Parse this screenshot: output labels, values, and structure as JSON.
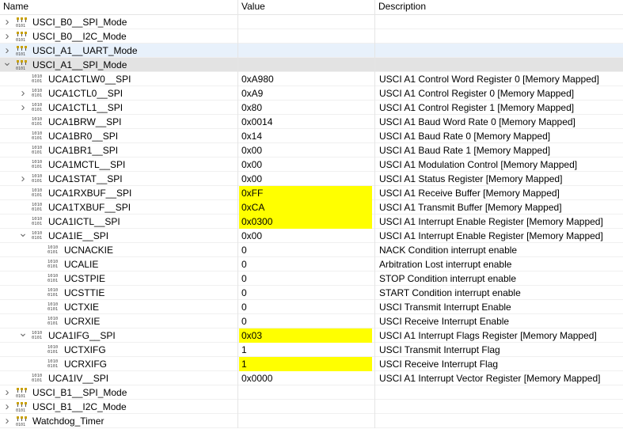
{
  "columns": {
    "name": "Name",
    "value": "Value",
    "description": "Description"
  },
  "colors": {
    "highlight": "#ffff00",
    "selected_light": "#e8f1fb",
    "selected_grey": "#e3e3e3"
  },
  "rows": [
    {
      "name": "USCI_B0__SPI_Mode",
      "value": "",
      "desc": "",
      "icon": "peripheral-icon",
      "expander": "collapsed"
    },
    {
      "name": "USCI_B0__I2C_Mode",
      "value": "",
      "desc": "",
      "icon": "peripheral-icon",
      "expander": "collapsed"
    },
    {
      "name": "USCI_A1__UART_Mode",
      "value": "",
      "desc": "",
      "icon": "peripheral-icon",
      "expander": "collapsed",
      "state": "hover"
    },
    {
      "name": "USCI_A1__SPI_Mode",
      "value": "",
      "desc": "",
      "icon": "peripheral-icon",
      "expander": "expanded",
      "state": "selected"
    },
    {
      "name": "UCA1CTLW0__SPI",
      "value": "0xA980",
      "desc": "USCI A1 Control Word Register 0 [Memory Mapped]",
      "icon": "register-icon",
      "expander": "none"
    },
    {
      "name": "UCA1CTL0__SPI",
      "value": "0xA9",
      "desc": "USCI A1 Control Register 0 [Memory Mapped]",
      "icon": "register-icon",
      "expander": "collapsed"
    },
    {
      "name": "UCA1CTL1__SPI",
      "value": "0x80",
      "desc": "USCI A1 Control Register 1 [Memory Mapped]",
      "icon": "register-icon",
      "expander": "collapsed"
    },
    {
      "name": "UCA1BRW__SPI",
      "value": "0x0014",
      "desc": "USCI A1 Baud Word Rate 0 [Memory Mapped]",
      "icon": "register-icon",
      "expander": "none"
    },
    {
      "name": "UCA1BR0__SPI",
      "value": "0x14",
      "desc": "USCI A1 Baud Rate 0 [Memory Mapped]",
      "icon": "register-icon",
      "expander": "none"
    },
    {
      "name": "UCA1BR1__SPI",
      "value": "0x00",
      "desc": "USCI A1 Baud Rate 1 [Memory Mapped]",
      "icon": "register-icon",
      "expander": "none"
    },
    {
      "name": "UCA1MCTL__SPI",
      "value": "0x00",
      "desc": "USCI A1 Modulation Control [Memory Mapped]",
      "icon": "register-icon",
      "expander": "none"
    },
    {
      "name": "UCA1STAT__SPI",
      "value": "0x00",
      "desc": "USCI A1 Status Register [Memory Mapped]",
      "icon": "register-icon",
      "expander": "collapsed"
    },
    {
      "name": "UCA1RXBUF__SPI",
      "value": "0xFF",
      "desc": "USCI A1 Receive Buffer [Memory Mapped]",
      "icon": "register-icon",
      "expander": "none",
      "changed": true
    },
    {
      "name": "UCA1TXBUF__SPI",
      "value": "0xCA",
      "desc": "USCI A1 Transmit Buffer [Memory Mapped]",
      "icon": "register-icon",
      "expander": "none",
      "changed": true
    },
    {
      "name": "UCA1ICTL__SPI",
      "value": "0x0300",
      "desc": "USCI A1 Interrupt Enable Register [Memory Mapped]",
      "icon": "register-icon",
      "expander": "none",
      "changed": true
    },
    {
      "name": "UCA1IE__SPI",
      "value": "0x00",
      "desc": "USCI A1 Interrupt Enable Register [Memory Mapped]",
      "icon": "register-icon",
      "expander": "expanded"
    },
    {
      "name": "UCNACKIE",
      "value": "0",
      "desc": "NACK Condition interrupt enable",
      "icon": "register-icon",
      "expander": "none",
      "level": 2
    },
    {
      "name": "UCALIE",
      "value": "0",
      "desc": "Arbitration Lost interrupt enable",
      "icon": "register-icon",
      "expander": "none",
      "level": 2
    },
    {
      "name": "UCSTPIE",
      "value": "0",
      "desc": "STOP Condition interrupt enable",
      "icon": "register-icon",
      "expander": "none",
      "level": 2
    },
    {
      "name": "UCSTTIE",
      "value": "0",
      "desc": "START Condition interrupt enable",
      "icon": "register-icon",
      "expander": "none",
      "level": 2
    },
    {
      "name": "UCTXIE",
      "value": "0",
      "desc": "USCI Transmit Interrupt Enable",
      "icon": "register-icon",
      "expander": "none",
      "level": 2
    },
    {
      "name": "UCRXIE",
      "value": "0",
      "desc": "USCI Receive Interrupt Enable",
      "icon": "register-icon",
      "expander": "none",
      "level": 2
    },
    {
      "name": "UCA1IFG__SPI",
      "value": "0x03",
      "desc": "USCI A1 Interrupt Flags Register [Memory Mapped]",
      "icon": "register-icon",
      "expander": "expanded",
      "changed": true
    },
    {
      "name": "UCTXIFG",
      "value": "1",
      "desc": "USCI Transmit Interrupt Flag",
      "icon": "register-icon",
      "expander": "none",
      "level": 2
    },
    {
      "name": "UCRXIFG",
      "value": "1",
      "desc": "USCI Receive Interrupt Flag",
      "icon": "register-icon",
      "expander": "none",
      "level": 2,
      "changed": true
    },
    {
      "name": "UCA1IV__SPI",
      "value": "0x0000",
      "desc": "USCI A1 Interrupt Vector Register [Memory Mapped]",
      "icon": "register-icon",
      "expander": "none"
    },
    {
      "name": "USCI_B1__SPI_Mode",
      "value": "",
      "desc": "",
      "icon": "peripheral-icon",
      "expander": "collapsed"
    },
    {
      "name": "USCI_B1__I2C_Mode",
      "value": "",
      "desc": "",
      "icon": "peripheral-icon",
      "expander": "collapsed"
    },
    {
      "name": "Watchdog_Timer",
      "value": "",
      "desc": "",
      "icon": "peripheral-icon",
      "expander": "collapsed"
    }
  ]
}
